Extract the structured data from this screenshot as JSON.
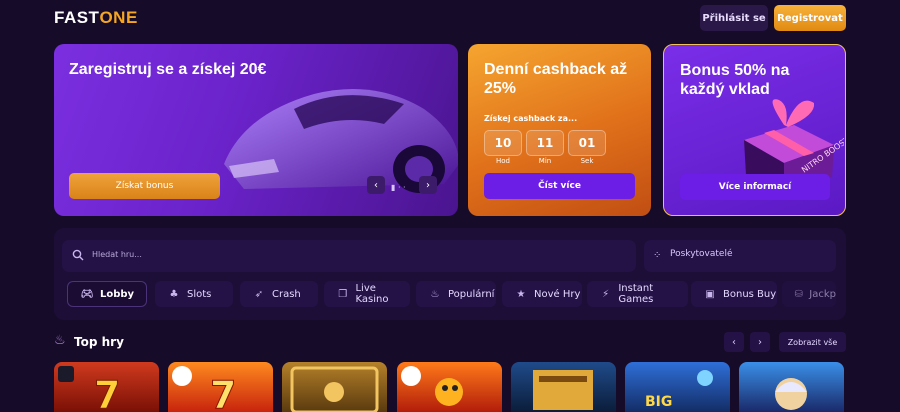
{
  "header": {
    "logo_part1": "FAST",
    "logo_part2": "ONE",
    "login_label": "Přihlásit se",
    "register_label": "Registrovat"
  },
  "promos": {
    "registration": {
      "title": "Zaregistruj se a získej 20€",
      "button": "Získat bonus",
      "pager_prev": "‹",
      "pager_next": "›"
    },
    "cashback": {
      "title": "Denní cashback až 25%",
      "subtitle": "Získej cashback za...",
      "timer": [
        {
          "value": "10",
          "label": "Hod"
        },
        {
          "value": "11",
          "label": "Min"
        },
        {
          "value": "01",
          "label": "Sek"
        }
      ],
      "button": "Číst více"
    },
    "bonus": {
      "title": "Bonus 50% na každý vklad",
      "gift_text": "NITRO BOOST",
      "button": "Více informací"
    }
  },
  "search": {
    "placeholder": "Hledat hru...",
    "providers_label": "Poskytovatelé"
  },
  "tabs": [
    {
      "label": "Lobby",
      "icon": "gamepad-icon"
    },
    {
      "label": "Slots",
      "icon": "slots-icon"
    },
    {
      "label": "Crash",
      "icon": "rocket-icon"
    },
    {
      "label": "Live Kasino",
      "icon": "cards-icon"
    },
    {
      "label": "Populární",
      "icon": "flame-icon"
    },
    {
      "label": "Nové Hry",
      "icon": "star-icon"
    },
    {
      "label": "Instant Games",
      "icon": "lightning-icon"
    },
    {
      "label": "Bonus Buy",
      "icon": "bonus-icon"
    },
    {
      "label": "Jackp",
      "icon": "jackpot-icon"
    }
  ],
  "top_games": {
    "title": "Top hry",
    "show_all": "Zobrazit vše",
    "prev": "‹",
    "next": "›"
  },
  "colors": {
    "background": "#170b2a",
    "accent_orange": "#f5a623",
    "accent_purple": "#6c1de6"
  }
}
